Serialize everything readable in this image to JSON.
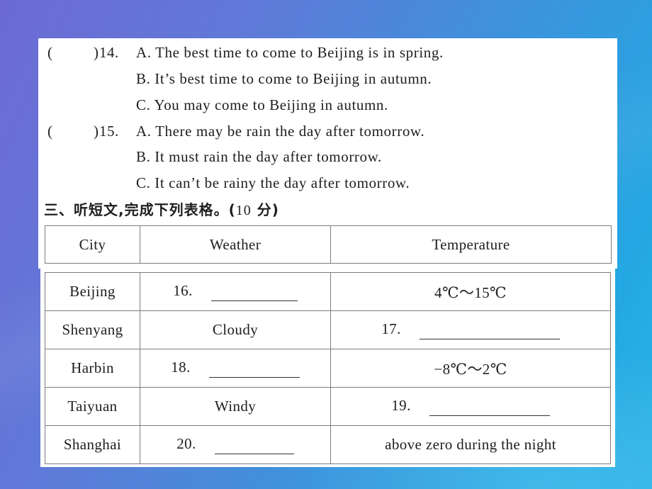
{
  "questions": [
    {
      "number": "14.",
      "answer_bracket_open": "(",
      "answer_bracket_close": ")",
      "options": [
        "A. The best time to come to Beijing is in spring.",
        "B. It’s best time to come to Beijing in autumn.",
        "C. You may come to Beijing in autumn."
      ]
    },
    {
      "number": "15.",
      "answer_bracket_open": "(",
      "answer_bracket_close": ")",
      "options": [
        "A. There may be rain the day after tomorrow.",
        "B. It must rain the day after tomorrow.",
        "C. It can’t be rainy the day after tomorrow."
      ]
    }
  ],
  "section": {
    "title": "三、听短文,完成下列表格。(",
    "points": "10",
    "points_suffix": " 分)"
  },
  "table": {
    "headers": [
      "City",
      "Weather",
      "Temperature"
    ],
    "rows": [
      {
        "city": "Beijing",
        "weather": {
          "blank_number": "16."
        },
        "temperature": {
          "text": "4℃～15℃"
        }
      },
      {
        "city": "Shenyang",
        "weather": {
          "text": "Cloudy"
        },
        "temperature": {
          "blank_number": "17."
        }
      },
      {
        "city": "Harbin",
        "weather": {
          "blank_number": "18."
        },
        "temperature": {
          "text": "−8℃～2℃"
        }
      },
      {
        "city": "Taiyuan",
        "weather": {
          "text": "Windy"
        },
        "temperature": {
          "blank_number": "19."
        }
      },
      {
        "city": "Shanghai",
        "weather": {
          "blank_number": "20."
        },
        "temperature": {
          "text": "above zero during the night"
        }
      }
    ]
  },
  "colors": {
    "background_left": "#6d6ad4",
    "background_right": "#2bb3e6",
    "panel": "#ffffff",
    "grid_line": "#7c7c7c",
    "text": "#1e1e1e"
  }
}
